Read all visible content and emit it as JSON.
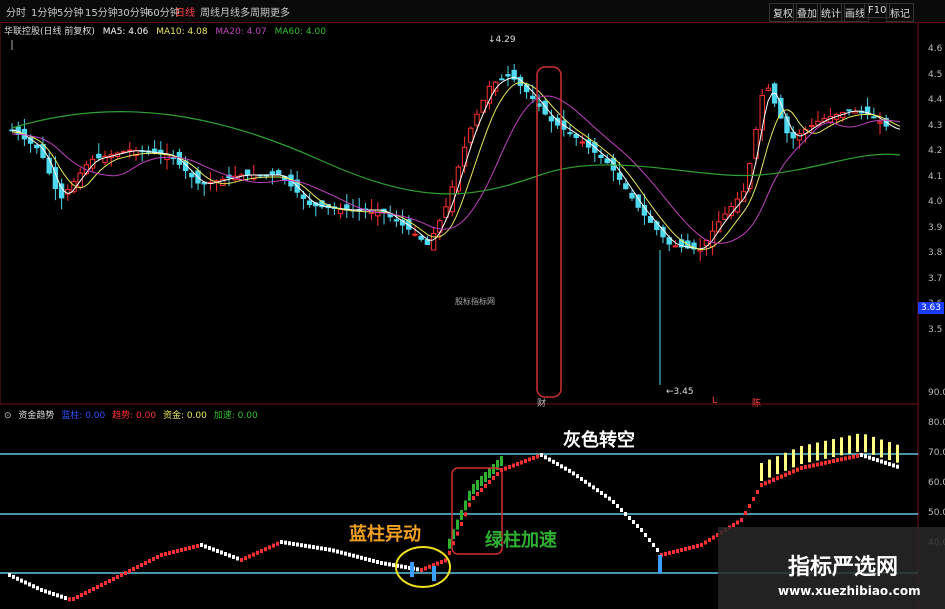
{
  "topbar": {
    "periods": [
      "分时",
      "1分钟",
      "5分钟",
      "15分钟",
      "30分钟",
      "60分钟",
      "日线",
      "周线",
      "月线",
      "多周期",
      "更多"
    ],
    "active_period": "日线",
    "right_buttons": [
      "复权",
      "叠加",
      "统计",
      "画线",
      "F10",
      "标记"
    ]
  },
  "main_legend": {
    "stock": "华联控股(日线 前复权)",
    "ma5": "MA5: 4.06",
    "ma10": "MA10: 4.08",
    "ma20": "MA20: 4.07",
    "ma60": "MA60: 4.00"
  },
  "price_axis": [
    "4.6",
    "4.5",
    "4.4",
    "4.3",
    "4.2",
    "4.1",
    "4.0",
    "3.9",
    "3.8",
    "3.7",
    "3.6",
    "3.5"
  ],
  "current_price_tag": "3.63",
  "high_label": "4.29",
  "low_label": "3.45",
  "watermark_small": "股标指标网",
  "event_markers": [
    "财",
    "L",
    "陈"
  ],
  "indicator_legend": {
    "name": "资金趋势",
    "l1": "蓝柱: 0.00",
    "l2": "趋势: 0.00",
    "l3": "资金: 0.00",
    "l4": "加速: 0.00"
  },
  "indicator_axis": [
    "90.0",
    "80.0",
    "70.0",
    "60.0",
    "50.0",
    "40.0"
  ],
  "annotations": {
    "gray_short": "灰色转空",
    "blue_move": "蓝柱异动",
    "green_accel": "绿柱加速"
  },
  "brand": {
    "title": "指标严选网",
    "url": "www.xuezhibiao.com"
  },
  "colors": {
    "up": "#ff3030",
    "down": "#4fd8f0",
    "ma5": "#ffffff",
    "ma10": "#e8e860",
    "ma20": "#c040c0",
    "ma60": "#30a030",
    "annot_white": "#ffffff",
    "annot_orange": "#f0a020",
    "annot_green": "#30b030"
  }
}
